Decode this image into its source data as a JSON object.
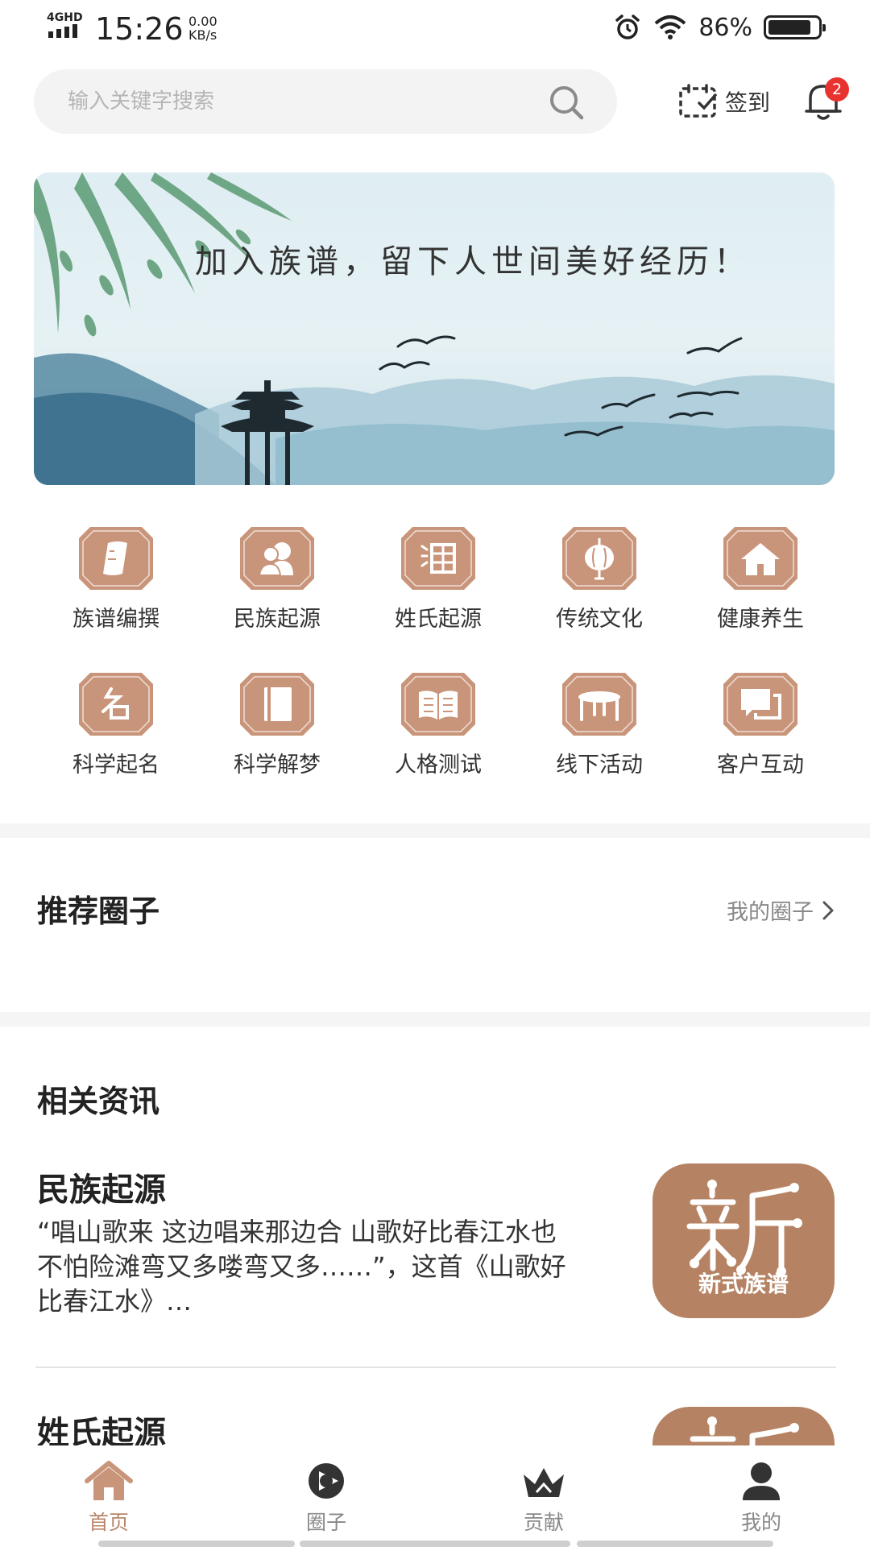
{
  "status_bar": {
    "network": "4GHD",
    "time": "15:26",
    "speed_value": "0.00",
    "speed_unit": "KB/s",
    "battery_percent": "86%",
    "battery_level": 0.86
  },
  "header": {
    "search_placeholder": "输入关键字搜索",
    "checkin_label": "签到",
    "notification_count": "2"
  },
  "banner": {
    "text": "加入族谱，留下人世间美好经历！"
  },
  "icon_grid": [
    {
      "label": "族谱编撰",
      "icon": "scroll-icon"
    },
    {
      "label": "民族起源",
      "icon": "people-icon"
    },
    {
      "label": "姓氏起源",
      "icon": "surname-seal-icon"
    },
    {
      "label": "传统文化",
      "icon": "lantern-icon"
    },
    {
      "label": "健康养生",
      "icon": "house-icon"
    },
    {
      "label": "科学起名",
      "icon": "name-character-icon"
    },
    {
      "label": "科学解梦",
      "icon": "book-icon"
    },
    {
      "label": "人格测试",
      "icon": "open-book-icon"
    },
    {
      "label": "线下活动",
      "icon": "table-icon"
    },
    {
      "label": "客户互动",
      "icon": "chat-icon"
    }
  ],
  "recommended": {
    "title": "推荐圈子",
    "link": "我的圈子"
  },
  "news": {
    "title": "相关资讯",
    "items": [
      {
        "title": "民族起源",
        "body": "“唱山歌来 这边唱来那边合 山歌好比春江水也 不怕险滩弯又多喽弯又多……”，这首《山歌好比春江水》…",
        "thumb_caption": "新式族谱"
      },
      {
        "title": "姓氏起源",
        "body": "",
        "thumb_caption": ""
      }
    ]
  },
  "tabbar": [
    {
      "label": "首页",
      "icon": "home-icon",
      "active": true
    },
    {
      "label": "圈子",
      "icon": "circle-play-icon",
      "active": false
    },
    {
      "label": "贡献",
      "icon": "crown-icon",
      "active": false
    },
    {
      "label": "我的",
      "icon": "user-icon",
      "active": false
    }
  ],
  "colors": {
    "accent": "#b8866a",
    "tile": "#c9957a",
    "badge": "#e8322f",
    "thumb": "#b58363"
  }
}
